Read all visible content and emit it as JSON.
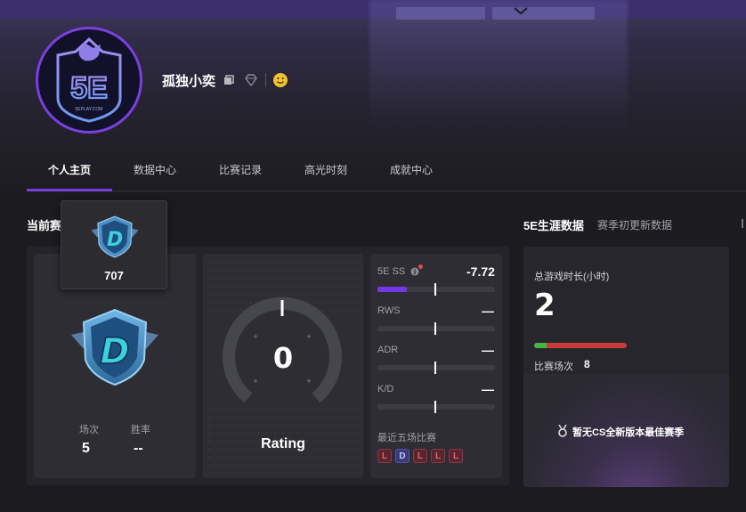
{
  "profile": {
    "name": "孤独小奕"
  },
  "tabs": [
    {
      "label": "个人主页",
      "active": true
    },
    {
      "label": "数据中心"
    },
    {
      "label": "比赛记录"
    },
    {
      "label": "高光时刻"
    },
    {
      "label": "成就中心"
    }
  ],
  "season": {
    "title_partial": "当前赛",
    "popup_score": "707",
    "rank_badge": "D",
    "matches_label": "场次",
    "matches_value": "5",
    "winrate_label": "胜率",
    "winrate_value": "--",
    "rating_value": "0",
    "rating_label": "Rating",
    "stats": [
      {
        "label": "5E SS",
        "value": "-7.72",
        "fill_pct": 25,
        "has_info": true,
        "has_dot": true
      },
      {
        "label": "RWS",
        "value": "—"
      },
      {
        "label": "ADR",
        "value": "—"
      },
      {
        "label": "K/D",
        "value": "—"
      }
    ],
    "recent_label": "最近五场比赛",
    "recent": [
      "L",
      "D",
      "L",
      "L",
      "L"
    ]
  },
  "career": {
    "title": "5E生涯数据",
    "subtitle": "赛季初更新数据",
    "playtime_label": "总游戏时长(小时)",
    "playtime_value": "2",
    "matches_label": "比赛场次",
    "matches_value": "8",
    "best_season_text": "暂无CS全新版本最佳赛季"
  },
  "colors": {
    "accent": "#7b3fe0",
    "loss": "#e46565",
    "draw": "#8a8aff",
    "win_bar": "#3fb83f",
    "loss_bar": "#c93b3b"
  }
}
